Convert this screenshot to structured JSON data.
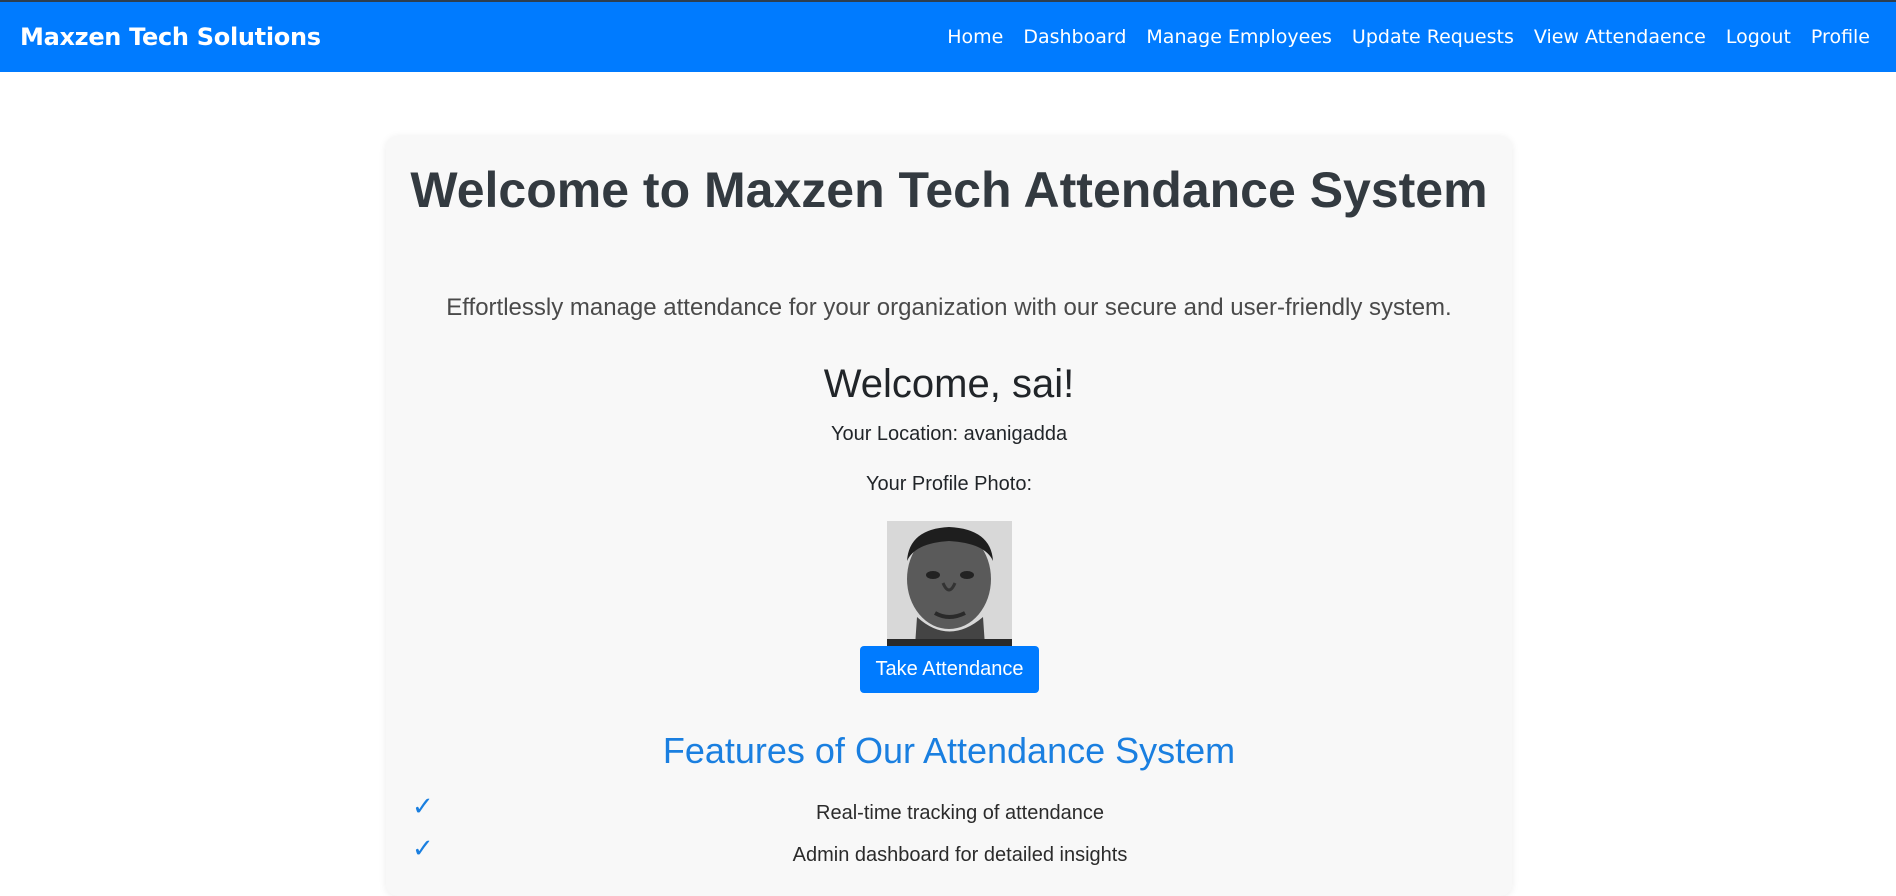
{
  "brand": "Maxzen Tech Solutions",
  "nav": {
    "items": [
      {
        "label": "Home"
      },
      {
        "label": "Dashboard"
      },
      {
        "label": "Manage Employees"
      },
      {
        "label": "Update Requests"
      },
      {
        "label": "View Attendaence"
      },
      {
        "label": "Logout"
      },
      {
        "label": "Profile"
      }
    ]
  },
  "hero": {
    "title": "Welcome to Maxzen Tech Attendance System",
    "subtitle": "Effortlessly manage attendance for your organization with our secure and user-friendly system."
  },
  "user": {
    "welcome": "Welcome, sai!",
    "location_text": "Your Location: avanigadda",
    "photo_label": "Your Profile Photo:"
  },
  "actions": {
    "take_attendance": "Take Attendance"
  },
  "features": {
    "title": "Features of Our Attendance System",
    "items": [
      {
        "text": "Real-time tracking of attendance",
        "icon": "check-icon"
      },
      {
        "text": "Admin dashboard for detailed insights",
        "icon": "check-icon"
      }
    ]
  },
  "colors": {
    "primary": "#007bff",
    "heading": "#333a40",
    "accent_text": "#1a7fe0",
    "card_bg": "#f8f8f8"
  }
}
